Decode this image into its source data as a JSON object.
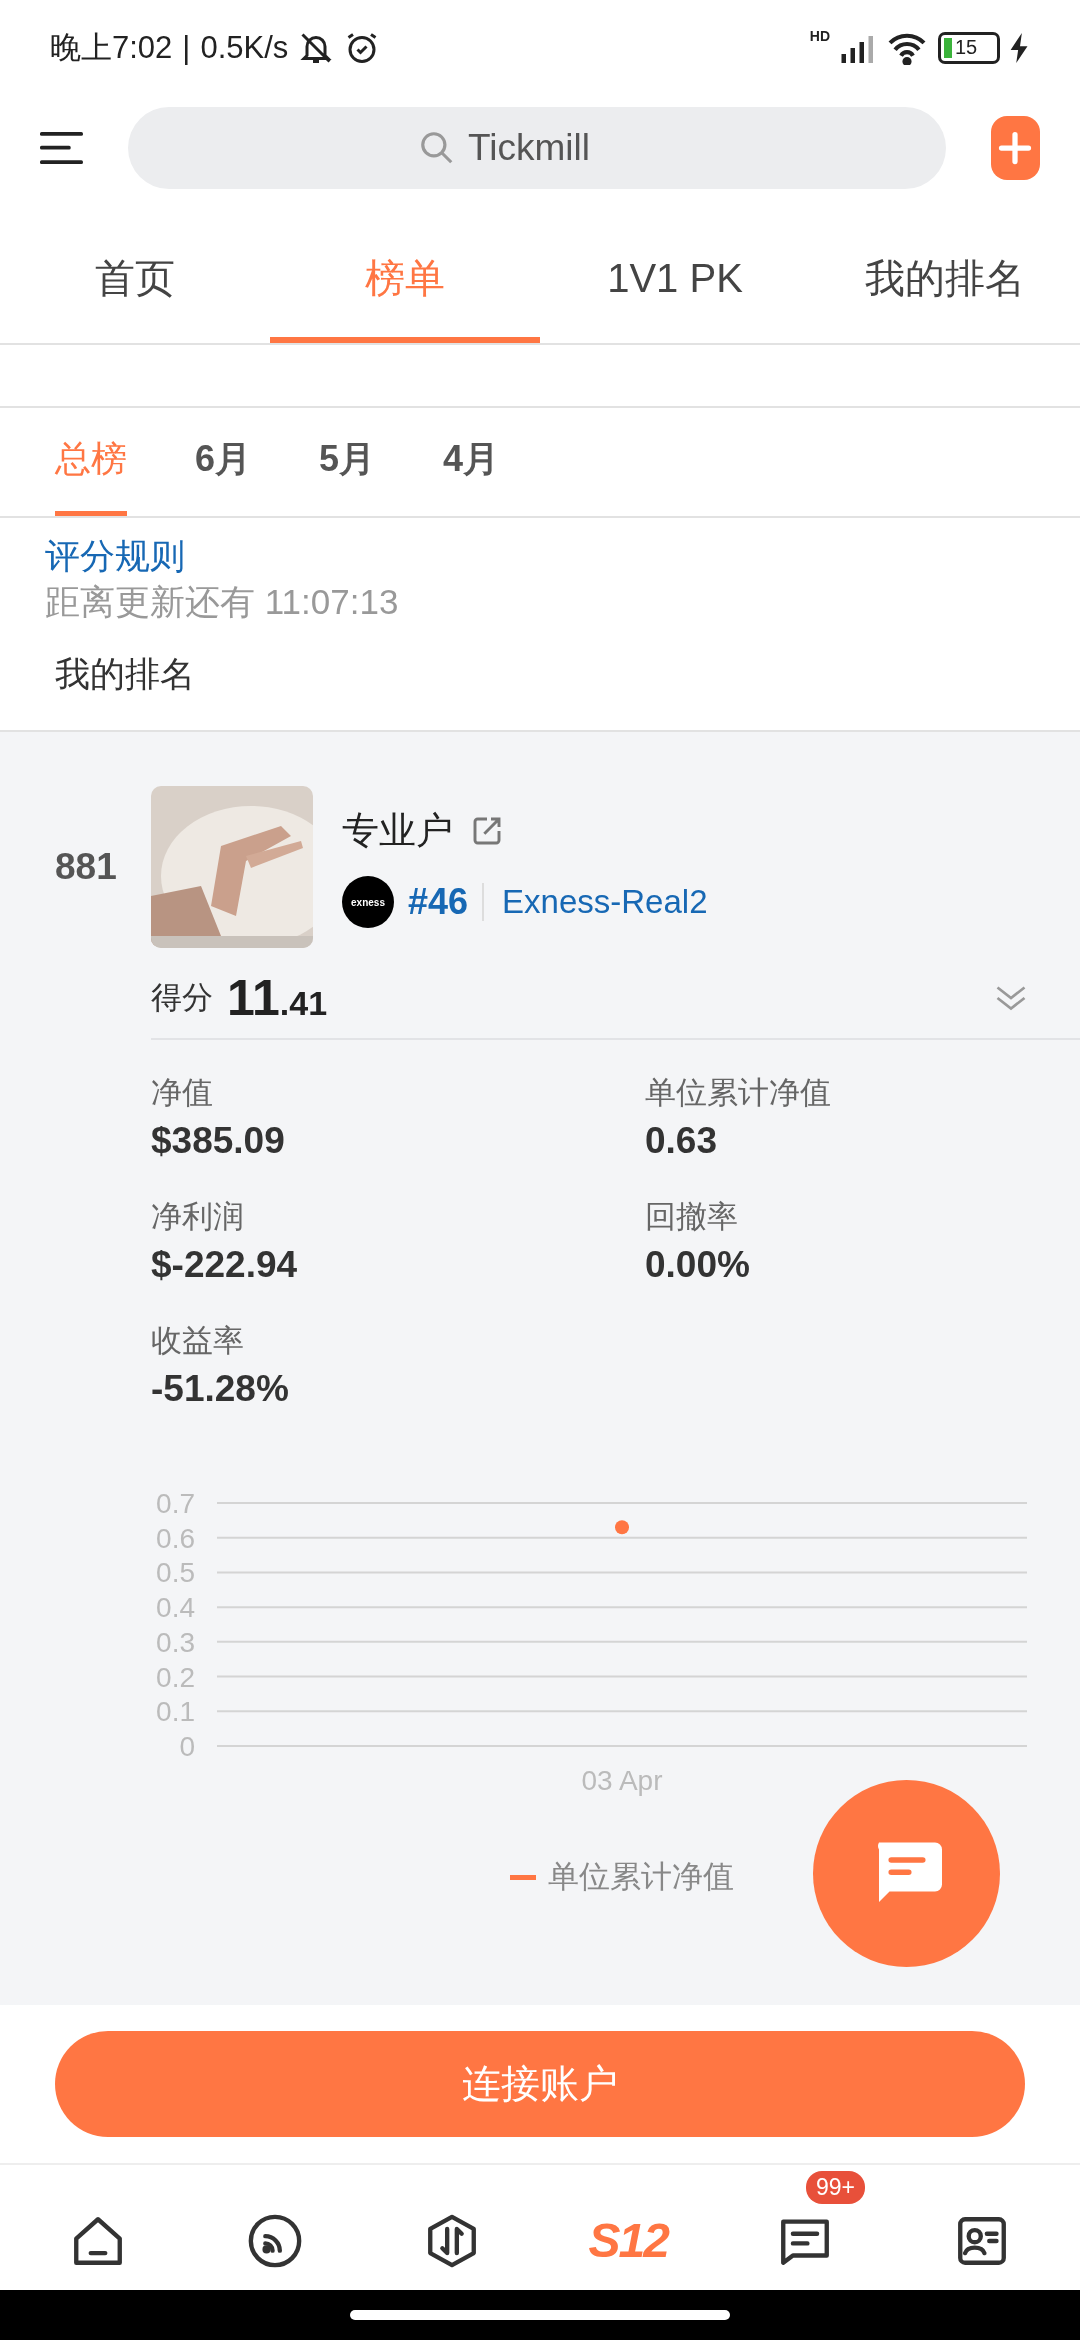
{
  "status_bar": {
    "time": "晚上7:02",
    "separator": "|",
    "speed": "0.5K/s",
    "network": "HD",
    "battery": "15"
  },
  "search": {
    "placeholder": "Tickmill"
  },
  "tabs": [
    {
      "label": "首页",
      "selected": false
    },
    {
      "label": "榜单",
      "selected": true
    },
    {
      "label": "1V1 PK",
      "selected": false
    },
    {
      "label": "我的排名",
      "selected": false
    }
  ],
  "period_tabs": [
    {
      "label": "总榜",
      "selected": true
    },
    {
      "label": "6月",
      "selected": false
    },
    {
      "label": "5月",
      "selected": false
    },
    {
      "label": "4月",
      "selected": false
    }
  ],
  "rules_link": "评分规则",
  "countdown": {
    "label": "距离更新还有",
    "time": "11:07:13"
  },
  "my_rank_heading": "我的排名",
  "entry": {
    "rank": "881",
    "name": "专业户",
    "broker_logo": "exness",
    "broker_rank": "#46",
    "server": "Exness-Real2",
    "score_label": "得分",
    "score_whole": "11",
    "score_fraction": ".41",
    "expanded": true,
    "metrics": [
      {
        "label": "净值",
        "value": "$385.09"
      },
      {
        "label": "单位累计净值",
        "value": "0.63"
      },
      {
        "label": "净利润",
        "value": "$-222.94"
      },
      {
        "label": "回撤率",
        "value": "0.00%"
      },
      {
        "label": "收益率",
        "value": "-51.28%"
      }
    ],
    "chart_data": {
      "type": "line",
      "grid": true,
      "categories": [
        "03 Apr"
      ],
      "ylim": [
        0,
        0.7
      ],
      "yticks": [
        0,
        0.1,
        0.2,
        0.3,
        0.4,
        0.5,
        0.6,
        0.7
      ],
      "series": [
        {
          "name": "单位累计净值",
          "color": "#ff7643",
          "marker": true,
          "values": [
            0.63
          ]
        }
      ]
    }
  },
  "connect_button": "连接账户",
  "bottom_nav": [
    {
      "kind": "home",
      "selected": false
    },
    {
      "kind": "feed",
      "selected": false
    },
    {
      "kind": "trade",
      "selected": false
    },
    {
      "kind": "brand",
      "label": "S12",
      "selected": true
    },
    {
      "kind": "messages",
      "badge": "99+",
      "selected": false
    },
    {
      "kind": "profile",
      "selected": false
    }
  ]
}
